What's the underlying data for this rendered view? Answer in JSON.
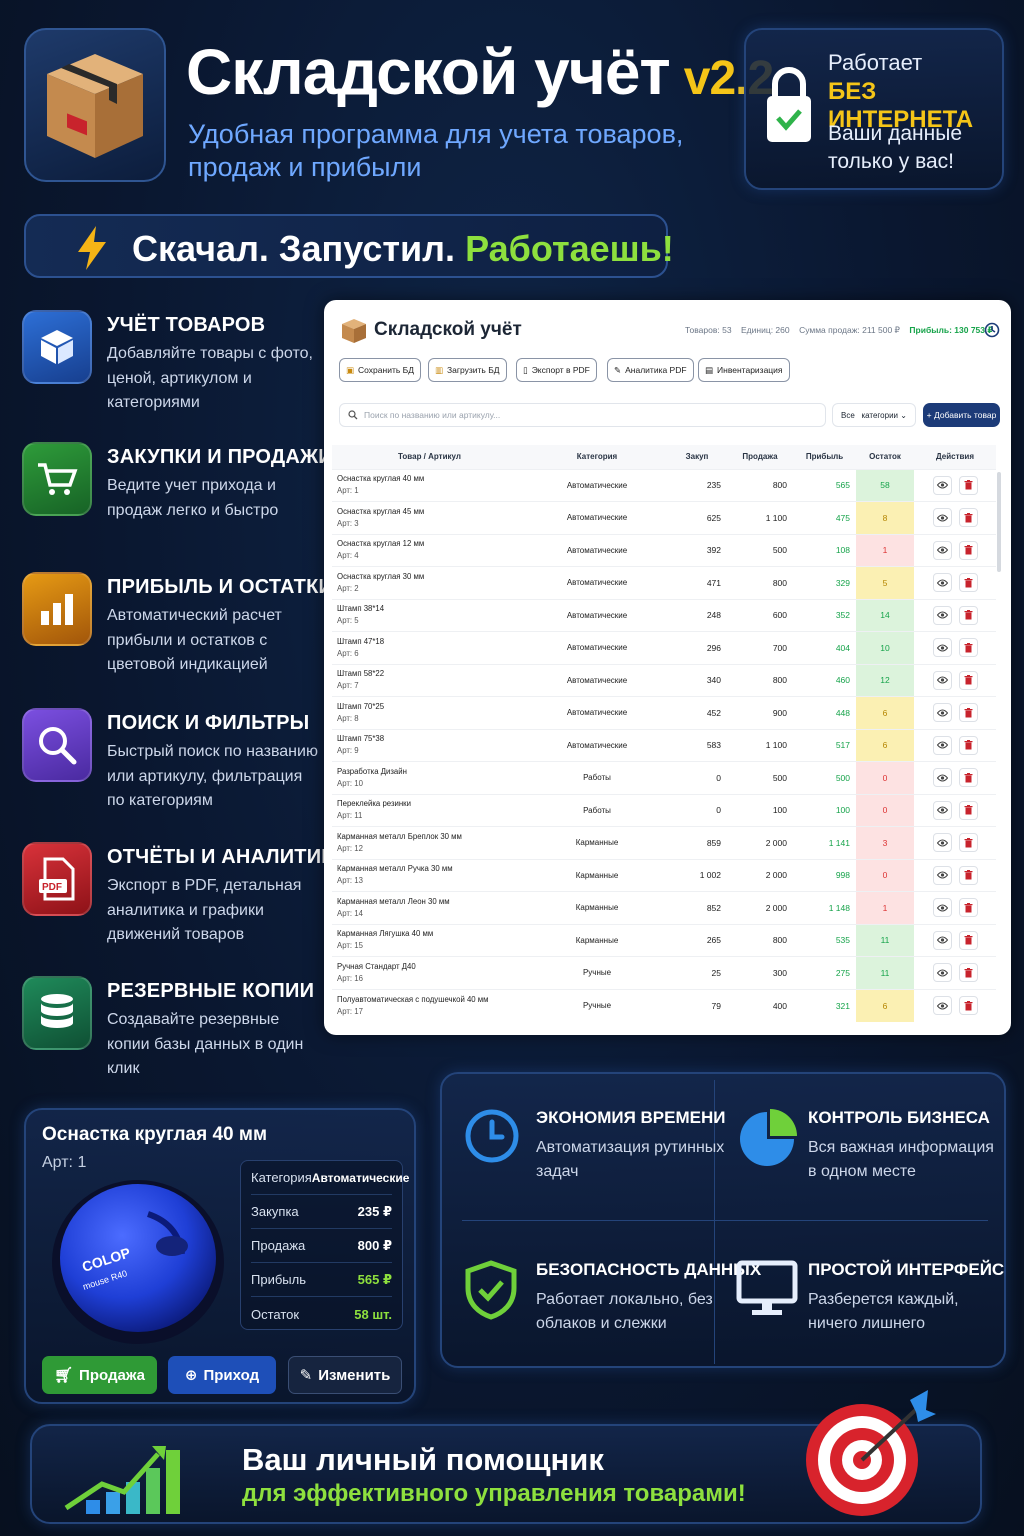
{
  "header": {
    "title": "Складской учёт",
    "version": "v2.2",
    "subtitle": "Удобная программа для учета товаров, продаж и прибыли"
  },
  "offline_badge": {
    "line1": "Работает",
    "line2": "БЕЗ ИНТЕРНЕТА",
    "line3": "Ваши данные только у вас!"
  },
  "slogan": {
    "part1": "Скачал. Запустил.",
    "part2": "Работаешь!"
  },
  "features": [
    {
      "title": "УЧЁТ ТОВАРОВ",
      "desc": "Добавляйте товары с фото, ценой, артикулом и категориями",
      "icon": "cube-icon"
    },
    {
      "title": "ЗАКУПКИ И ПРОДАЖИ",
      "desc": "Ведите учет прихода и продаж легко и быстро",
      "icon": "cart-icon"
    },
    {
      "title": "ПРИБЫЛЬ И ОСТАТКИ",
      "desc": "Автоматический расчет прибыли и остатков с цветовой индикацией",
      "icon": "bar-chart-icon"
    },
    {
      "title": "ПОИСК И ФИЛЬТРЫ",
      "desc": "Быстрый поиск по названию или артикулу, фильтрация по категориям",
      "icon": "search-icon"
    },
    {
      "title": "ОТЧЁТЫ И АНАЛИТИКА",
      "desc": "Экспорт в PDF, детальная аналитика и графики движений товаров",
      "icon": "pdf-icon"
    },
    {
      "title": "РЕЗЕРВНЫЕ КОПИИ",
      "desc": "Создавайте резервные копии базы данных в один клик",
      "icon": "database-icon"
    }
  ],
  "app": {
    "title": "Складской учёт",
    "stats": {
      "items": "Товаров: 53",
      "units": "Единиц: 260",
      "sales": "Сумма продаж: 211 500 ₽",
      "profit": "Прибыль: 130 753 ₽"
    },
    "toolbar": [
      "Сохранить БД",
      "Загрузить БД",
      "Экспорт в PDF",
      "Аналитика PDF",
      "Инвентаризация"
    ],
    "search_placeholder": "Поиск по названию или артикулу...",
    "category_filter": "Все   категории",
    "add_button": "+ Добавить товар",
    "columns": [
      "Товар / Артикул",
      "Категория",
      "Закуп",
      "Продажа",
      "Прибыль",
      "Остаток",
      "Действия"
    ],
    "rows": [
      {
        "name": "Оснастка круглая 40 мм",
        "art": "Арт: 1",
        "cat": "Автоматические",
        "buy": "235",
        "sell": "800",
        "profit": "565",
        "stock": "58",
        "level": "gr"
      },
      {
        "name": "Оснастка круглая 45 мм",
        "art": "Арт: 3",
        "cat": "Автоматические",
        "buy": "625",
        "sell": "1 100",
        "profit": "475",
        "stock": "8",
        "level": "ye"
      },
      {
        "name": "Оснастка круглая 12 мм",
        "art": "Арт: 4",
        "cat": "Автоматические",
        "buy": "392",
        "sell": "500",
        "profit": "108",
        "stock": "1",
        "level": "re"
      },
      {
        "name": "Оснастка круглая 30 мм",
        "art": "Арт: 2",
        "cat": "Автоматические",
        "buy": "471",
        "sell": "800",
        "profit": "329",
        "stock": "5",
        "level": "ye"
      },
      {
        "name": "Штамп 38*14",
        "art": "Арт: 5",
        "cat": "Автоматические",
        "buy": "248",
        "sell": "600",
        "profit": "352",
        "stock": "14",
        "level": "gr"
      },
      {
        "name": "Штамп 47*18",
        "art": "Арт: 6",
        "cat": "Автоматические",
        "buy": "296",
        "sell": "700",
        "profit": "404",
        "stock": "10",
        "level": "gr"
      },
      {
        "name": "Штамп 58*22",
        "art": "Арт: 7",
        "cat": "Автоматические",
        "buy": "340",
        "sell": "800",
        "profit": "460",
        "stock": "12",
        "level": "gr"
      },
      {
        "name": "Штамп 70*25",
        "art": "Арт: 8",
        "cat": "Автоматические",
        "buy": "452",
        "sell": "900",
        "profit": "448",
        "stock": "6",
        "level": "ye"
      },
      {
        "name": "Штамп 75*38",
        "art": "Арт: 9",
        "cat": "Автоматические",
        "buy": "583",
        "sell": "1 100",
        "profit": "517",
        "stock": "6",
        "level": "ye"
      },
      {
        "name": "Разработка Дизайн",
        "art": "Арт: 10",
        "cat": "Работы",
        "buy": "0",
        "sell": "500",
        "profit": "500",
        "stock": "0",
        "level": "re"
      },
      {
        "name": "Переклейка резинки",
        "art": "Арт: 11",
        "cat": "Работы",
        "buy": "0",
        "sell": "100",
        "profit": "100",
        "stock": "0",
        "level": "re"
      },
      {
        "name": "Карманная металл Бреплок 30 мм",
        "art": "Арт: 12",
        "cat": "Карманные",
        "buy": "859",
        "sell": "2 000",
        "profit": "1 141",
        "stock": "3",
        "level": "re"
      },
      {
        "name": "Карманная металл Ручка 30 мм",
        "art": "Арт: 13",
        "cat": "Карманные",
        "buy": "1 002",
        "sell": "2 000",
        "profit": "998",
        "stock": "0",
        "level": "re"
      },
      {
        "name": "Карманная металл Леон 30 мм",
        "art": "Арт: 14",
        "cat": "Карманные",
        "buy": "852",
        "sell": "2 000",
        "profit": "1 148",
        "stock": "1",
        "level": "re"
      },
      {
        "name": "Карманная Лягушка 40 мм",
        "art": "Арт: 15",
        "cat": "Карманные",
        "buy": "265",
        "sell": "800",
        "profit": "535",
        "stock": "11",
        "level": "gr"
      },
      {
        "name": "Ручная Стандарт Д40",
        "art": "Арт: 16",
        "cat": "Ручные",
        "buy": "25",
        "sell": "300",
        "profit": "275",
        "stock": "11",
        "level": "gr"
      },
      {
        "name": "Полуавтоматическая с подушечкой 40 мм",
        "art": "Арт: 17",
        "cat": "Ручные",
        "buy": "79",
        "sell": "400",
        "profit": "321",
        "stock": "6",
        "level": "ye"
      }
    ]
  },
  "product_card": {
    "name": "Оснастка круглая 40 мм",
    "art": "Арт: 1",
    "category_label": "Категория",
    "category_value": "Автоматические",
    "buy_label": "Закупка",
    "buy_value": "235 ₽",
    "sell_label": "Продажа",
    "sell_value": "800 ₽",
    "profit_label": "Прибыль",
    "profit_value": "565 ₽",
    "stock_label": "Остаток",
    "stock_value": "58 шт.",
    "stamp_text": "COLOP Printer mouse R40",
    "btn_sale": "Продажа",
    "btn_income": "Приход",
    "btn_edit": "Изменить"
  },
  "benefits": [
    {
      "title": "ЭКОНОМИЯ ВРЕМЕНИ",
      "desc": "Автоматизация рутинных задач"
    },
    {
      "title": "КОНТРОЛЬ БИЗНЕСА",
      "desc": "Вся важная информация в одном месте"
    },
    {
      "title": "БЕЗОПАСНОСТЬ ДАННЫХ",
      "desc": "Работает локально, без облаков и слежки"
    },
    {
      "title": "ПРОСТОЙ ИНТЕРФЕЙС",
      "desc": "Разберется каждый, ничего лишнего"
    }
  ],
  "footer": {
    "line1": "Ваш личный помощник",
    "line2": "для эффективного управления товарами!"
  },
  "colors": {
    "accent_green": "#8ee03e",
    "accent_yellow": "#f5c518",
    "accent_blue": "#6fa8ff",
    "app_primary": "#1c3b78"
  }
}
